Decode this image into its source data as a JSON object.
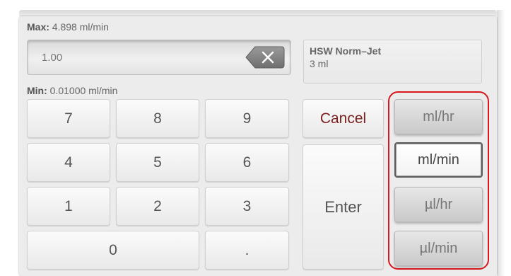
{
  "limits": {
    "max_prefix": "Max:",
    "max_value": "4.898 ml/min",
    "min_prefix": "Min:",
    "min_value": "0.01000 ml/min"
  },
  "rate_input": {
    "value": "1.00",
    "backspace_icon": "backspace-clear-icon"
  },
  "syringe_info": {
    "name": "HSW Norm–Jet",
    "volume": "3 ml"
  },
  "keypad": {
    "keys": [
      "7",
      "8",
      "9",
      "4",
      "5",
      "6",
      "1",
      "2",
      "3",
      "0",
      "."
    ],
    "cancel_label": "Cancel",
    "enter_label": "Enter"
  },
  "units": {
    "options": [
      "ml/hr",
      "ml/min",
      "µl/hr",
      "µl/min"
    ],
    "selected": "ml/min",
    "highlight_color": "#d9181e"
  },
  "colors": {
    "cancel_text": "#7a1f1f",
    "panel_bg": "#ececec"
  }
}
